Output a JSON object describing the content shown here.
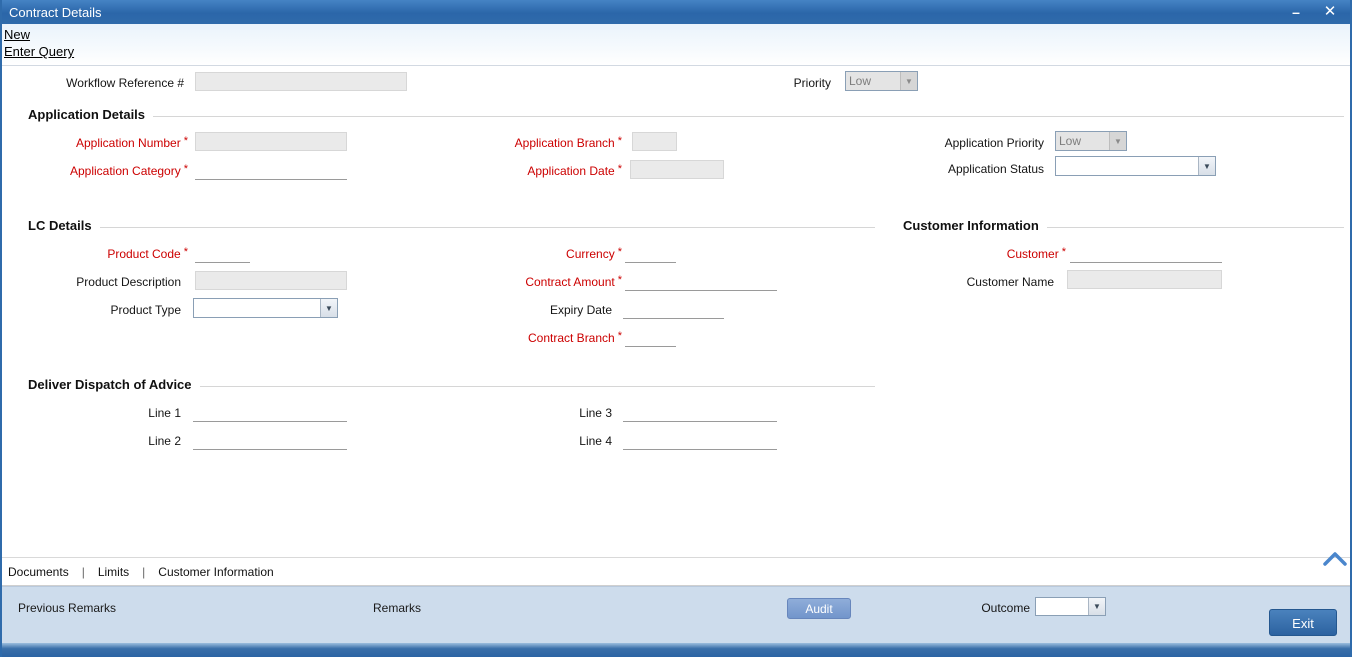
{
  "window": {
    "title": "Contract Details"
  },
  "icons": {
    "minimize": "–",
    "close": "✕",
    "chevron_down": "▼"
  },
  "menu": {
    "new": "New",
    "enter_query": "Enter Query"
  },
  "top": {
    "workflow_reference": {
      "label": "Workflow Reference #",
      "value": ""
    },
    "priority": {
      "label": "Priority",
      "value": "Low"
    }
  },
  "application_details": {
    "title": "Application Details",
    "application_number": {
      "label": "Application Number",
      "required": "*",
      "value": ""
    },
    "application_branch": {
      "label": "Application Branch",
      "required": "*",
      "value": ""
    },
    "application_priority": {
      "label": "Application Priority",
      "value": "Low"
    },
    "application_category": {
      "label": "Application Category",
      "required": "*",
      "value": ""
    },
    "application_date": {
      "label": "Application Date",
      "required": "*",
      "value": ""
    },
    "application_status": {
      "label": "Application Status",
      "value": ""
    }
  },
  "lc_details": {
    "title": "LC Details",
    "product_code": {
      "label": "Product Code",
      "required": "*",
      "value": ""
    },
    "product_description": {
      "label": "Product Description",
      "value": ""
    },
    "product_type": {
      "label": "Product Type",
      "value": ""
    },
    "currency": {
      "label": "Currency",
      "required": "*",
      "value": ""
    },
    "contract_amount": {
      "label": "Contract Amount",
      "required": "*",
      "value": ""
    },
    "expiry_date": {
      "label": "Expiry Date",
      "value": ""
    },
    "contract_branch": {
      "label": "Contract Branch",
      "required": "*",
      "value": ""
    }
  },
  "customer_information": {
    "title": "Customer Information",
    "customer": {
      "label": "Customer",
      "required": "*",
      "value": ""
    },
    "customer_name": {
      "label": "Customer Name",
      "value": ""
    }
  },
  "deliver_dispatch": {
    "title": "Deliver Dispatch of Advice",
    "line1": {
      "label": "Line 1",
      "value": ""
    },
    "line2": {
      "label": "Line 2",
      "value": ""
    },
    "line3": {
      "label": "Line 3",
      "value": ""
    },
    "line4": {
      "label": "Line 4",
      "value": ""
    }
  },
  "bottom_tabs": {
    "separator": "|",
    "documents": "Documents",
    "limits": "Limits",
    "customer_information": "Customer Information"
  },
  "footer": {
    "previous_remarks": "Previous Remarks",
    "remarks": "Remarks",
    "audit": "Audit",
    "outcome_label": "Outcome",
    "outcome_value": "",
    "exit": "Exit"
  },
  "colors": {
    "titlebar_blue": "#2f6bab",
    "footer_bg": "#cddcec",
    "required_red": "#cc0000",
    "exit_button": "#2c62a0",
    "audit_button": "#7295cb"
  }
}
